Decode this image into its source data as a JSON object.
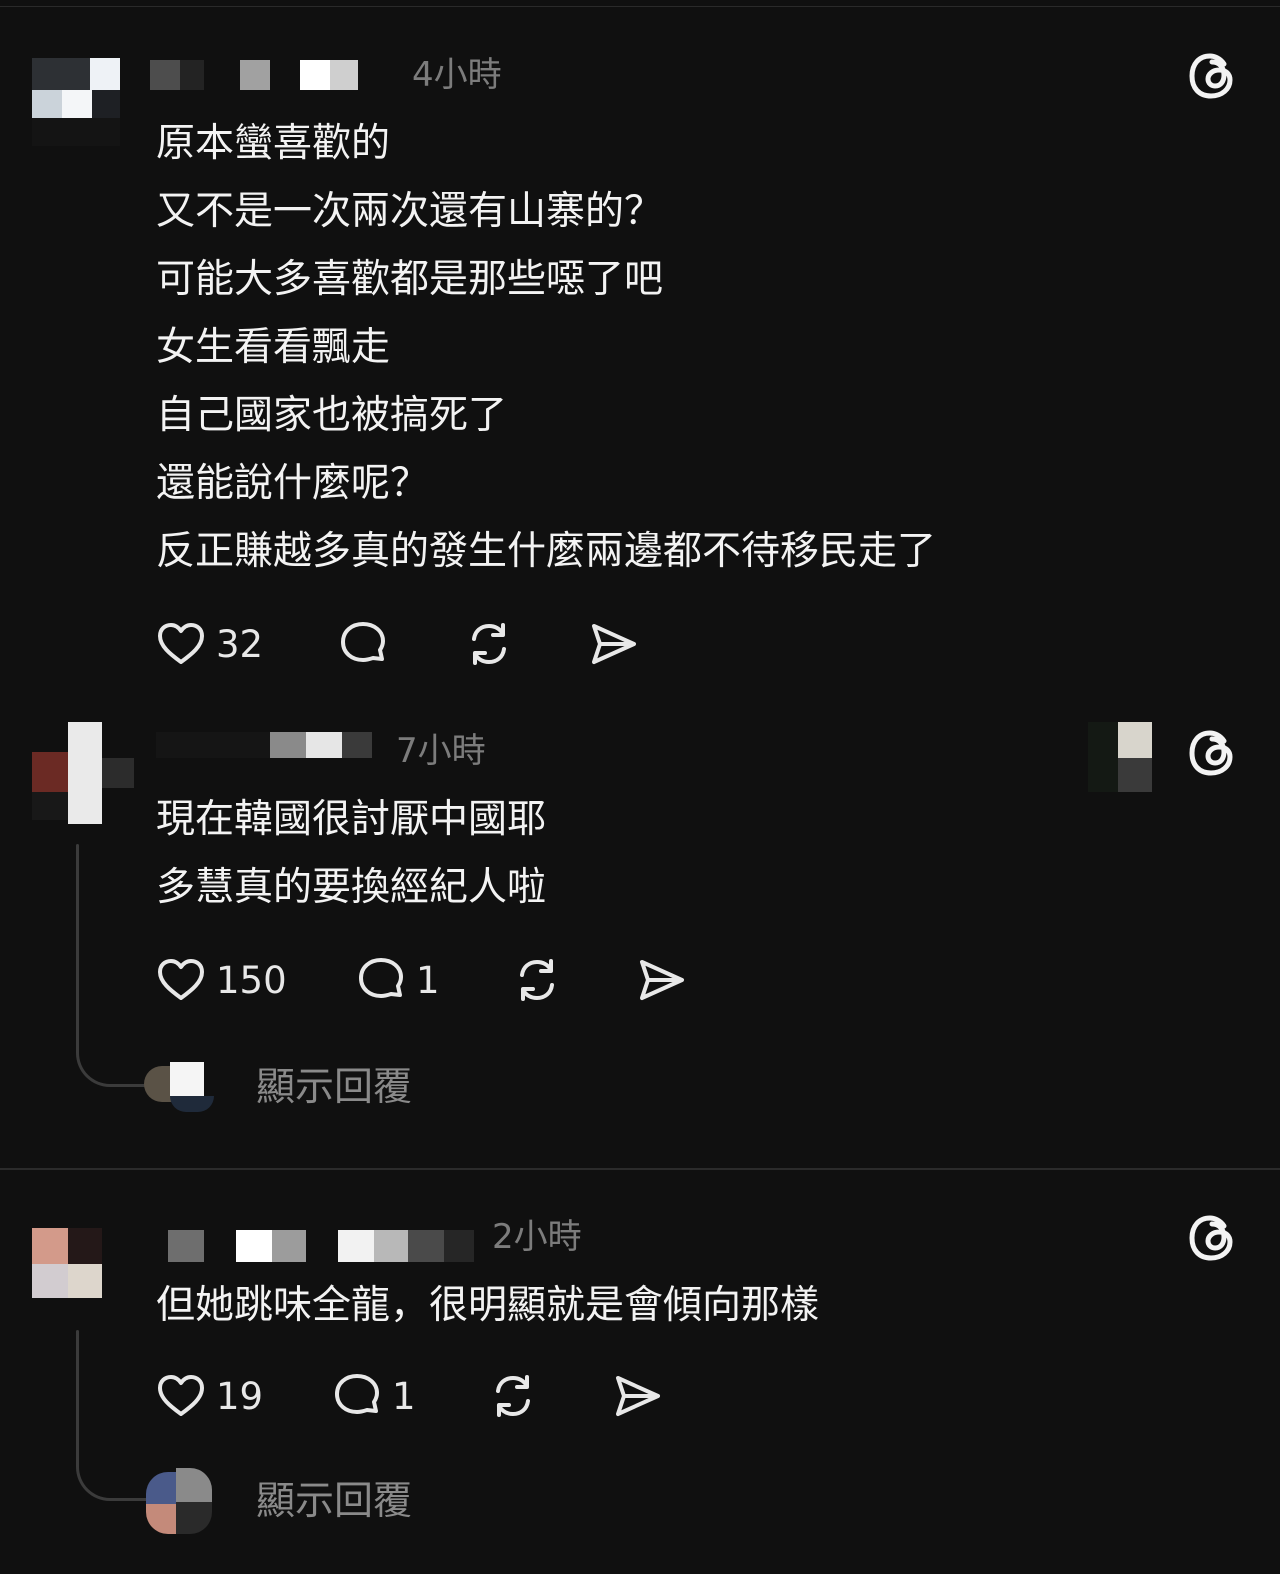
{
  "posts": [
    {
      "time": "4小時",
      "lines": [
        "原本蠻喜歡的",
        "又不是一次兩次還有山寨的？",
        "可能大多喜歡都是那些噁了吧",
        "女生看看飄走",
        "自己國家也被搞死了",
        "還能說什麼呢？",
        "反正賺越多真的發生什麼兩邊都不待移民走了"
      ],
      "likes": "32",
      "comments": ""
    },
    {
      "time": "7小時",
      "lines": [
        "現在韓國很討厭中國耶",
        "多慧真的要換經紀人啦"
      ],
      "likes": "150",
      "comments": "1",
      "show_replies": "顯示回覆"
    },
    {
      "time": "2小時",
      "lines": [
        "但她跳味全龍，很明顯就是會傾向那樣"
      ],
      "likes": "19",
      "comments": "1",
      "show_replies": "顯示回覆"
    }
  ],
  "icons": {
    "like": "heart-icon",
    "comment": "comment-bubble-icon",
    "repost": "repost-icon",
    "share": "send-icon",
    "app": "threads-logo-icon"
  },
  "colors": {
    "background": "#101010",
    "text": "#f3f3f3",
    "muted": "#7c7c7c"
  }
}
